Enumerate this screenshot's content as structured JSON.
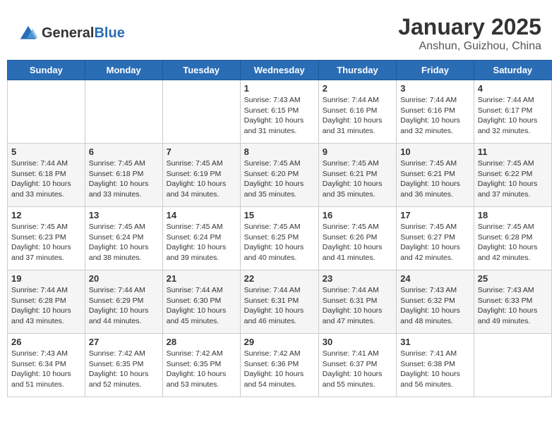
{
  "header": {
    "logo_general": "General",
    "logo_blue": "Blue",
    "month": "January 2025",
    "location": "Anshun, Guizhou, China"
  },
  "days_of_week": [
    "Sunday",
    "Monday",
    "Tuesday",
    "Wednesday",
    "Thursday",
    "Friday",
    "Saturday"
  ],
  "weeks": [
    [
      {
        "day": "",
        "info": ""
      },
      {
        "day": "",
        "info": ""
      },
      {
        "day": "",
        "info": ""
      },
      {
        "day": "1",
        "info": "Sunrise: 7:43 AM\nSunset: 6:15 PM\nDaylight: 10 hours and 31 minutes."
      },
      {
        "day": "2",
        "info": "Sunrise: 7:44 AM\nSunset: 6:16 PM\nDaylight: 10 hours and 31 minutes."
      },
      {
        "day": "3",
        "info": "Sunrise: 7:44 AM\nSunset: 6:16 PM\nDaylight: 10 hours and 32 minutes."
      },
      {
        "day": "4",
        "info": "Sunrise: 7:44 AM\nSunset: 6:17 PM\nDaylight: 10 hours and 32 minutes."
      }
    ],
    [
      {
        "day": "5",
        "info": "Sunrise: 7:44 AM\nSunset: 6:18 PM\nDaylight: 10 hours and 33 minutes."
      },
      {
        "day": "6",
        "info": "Sunrise: 7:45 AM\nSunset: 6:18 PM\nDaylight: 10 hours and 33 minutes."
      },
      {
        "day": "7",
        "info": "Sunrise: 7:45 AM\nSunset: 6:19 PM\nDaylight: 10 hours and 34 minutes."
      },
      {
        "day": "8",
        "info": "Sunrise: 7:45 AM\nSunset: 6:20 PM\nDaylight: 10 hours and 35 minutes."
      },
      {
        "day": "9",
        "info": "Sunrise: 7:45 AM\nSunset: 6:21 PM\nDaylight: 10 hours and 35 minutes."
      },
      {
        "day": "10",
        "info": "Sunrise: 7:45 AM\nSunset: 6:21 PM\nDaylight: 10 hours and 36 minutes."
      },
      {
        "day": "11",
        "info": "Sunrise: 7:45 AM\nSunset: 6:22 PM\nDaylight: 10 hours and 37 minutes."
      }
    ],
    [
      {
        "day": "12",
        "info": "Sunrise: 7:45 AM\nSunset: 6:23 PM\nDaylight: 10 hours and 37 minutes."
      },
      {
        "day": "13",
        "info": "Sunrise: 7:45 AM\nSunset: 6:24 PM\nDaylight: 10 hours and 38 minutes."
      },
      {
        "day": "14",
        "info": "Sunrise: 7:45 AM\nSunset: 6:24 PM\nDaylight: 10 hours and 39 minutes."
      },
      {
        "day": "15",
        "info": "Sunrise: 7:45 AM\nSunset: 6:25 PM\nDaylight: 10 hours and 40 minutes."
      },
      {
        "day": "16",
        "info": "Sunrise: 7:45 AM\nSunset: 6:26 PM\nDaylight: 10 hours and 41 minutes."
      },
      {
        "day": "17",
        "info": "Sunrise: 7:45 AM\nSunset: 6:27 PM\nDaylight: 10 hours and 42 minutes."
      },
      {
        "day": "18",
        "info": "Sunrise: 7:45 AM\nSunset: 6:28 PM\nDaylight: 10 hours and 42 minutes."
      }
    ],
    [
      {
        "day": "19",
        "info": "Sunrise: 7:44 AM\nSunset: 6:28 PM\nDaylight: 10 hours and 43 minutes."
      },
      {
        "day": "20",
        "info": "Sunrise: 7:44 AM\nSunset: 6:29 PM\nDaylight: 10 hours and 44 minutes."
      },
      {
        "day": "21",
        "info": "Sunrise: 7:44 AM\nSunset: 6:30 PM\nDaylight: 10 hours and 45 minutes."
      },
      {
        "day": "22",
        "info": "Sunrise: 7:44 AM\nSunset: 6:31 PM\nDaylight: 10 hours and 46 minutes."
      },
      {
        "day": "23",
        "info": "Sunrise: 7:44 AM\nSunset: 6:31 PM\nDaylight: 10 hours and 47 minutes."
      },
      {
        "day": "24",
        "info": "Sunrise: 7:43 AM\nSunset: 6:32 PM\nDaylight: 10 hours and 48 minutes."
      },
      {
        "day": "25",
        "info": "Sunrise: 7:43 AM\nSunset: 6:33 PM\nDaylight: 10 hours and 49 minutes."
      }
    ],
    [
      {
        "day": "26",
        "info": "Sunrise: 7:43 AM\nSunset: 6:34 PM\nDaylight: 10 hours and 51 minutes."
      },
      {
        "day": "27",
        "info": "Sunrise: 7:42 AM\nSunset: 6:35 PM\nDaylight: 10 hours and 52 minutes."
      },
      {
        "day": "28",
        "info": "Sunrise: 7:42 AM\nSunset: 6:35 PM\nDaylight: 10 hours and 53 minutes."
      },
      {
        "day": "29",
        "info": "Sunrise: 7:42 AM\nSunset: 6:36 PM\nDaylight: 10 hours and 54 minutes."
      },
      {
        "day": "30",
        "info": "Sunrise: 7:41 AM\nSunset: 6:37 PM\nDaylight: 10 hours and 55 minutes."
      },
      {
        "day": "31",
        "info": "Sunrise: 7:41 AM\nSunset: 6:38 PM\nDaylight: 10 hours and 56 minutes."
      },
      {
        "day": "",
        "info": ""
      }
    ]
  ]
}
